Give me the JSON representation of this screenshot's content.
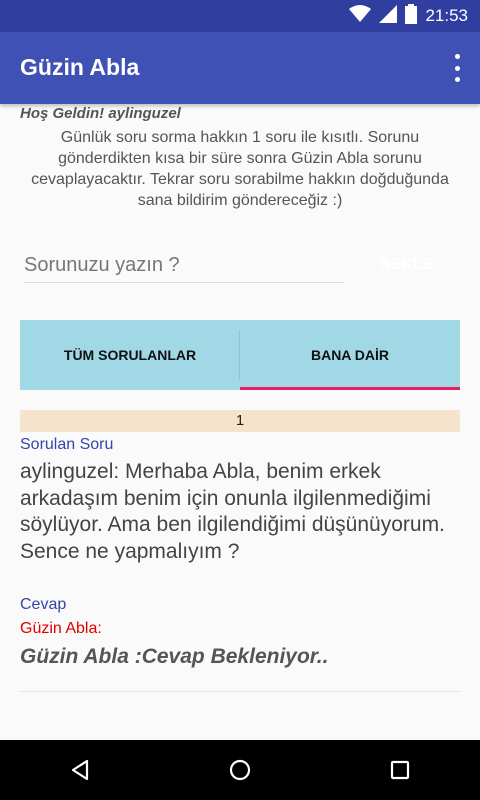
{
  "status_bar": {
    "time": "21:53"
  },
  "app_bar": {
    "title": "Güzin Abla"
  },
  "welcome": "Hoş Geldin! aylinguzel",
  "info_text": "Günlük soru sorma hakkın 1 soru ile kısıtlı. Sorunu gönderdikten kısa bir süre sonra Güzin Abla sorunu cevaplayacaktır. Tekrar soru sorabilme hakkın doğduğunda sana bildirim göndereceğiz :)",
  "ask": {
    "placeholder": "Sorunuzu yazın ?",
    "button_label": "BEKLE"
  },
  "tabs": [
    {
      "label": "TÜM SORULANLAR",
      "active": false
    },
    {
      "label": "BANA DAİR",
      "active": true
    }
  ],
  "entry": {
    "number": "1",
    "question_label": "Sorulan Soru",
    "question": "aylinguzel: Merhaba Abla, benim erkek arkadaşım benim için onunla ilgilenmediğimi söylüyor. Ama ben ilgilendiğimi düşünüyorum. Sence ne yapmalıyım ?",
    "answer_label": "Cevap",
    "answer_author": "Güzin Abla:",
    "answer": "Güzin Abla :Cevap Bekleniyor.."
  },
  "colors": {
    "status_bar": "#303F9F",
    "app_bar": "#3F51B5",
    "tabs_bg": "#A0D8E6",
    "tab_indicator": "#E91E63",
    "counter_bg": "#F5E3CC",
    "label_blue": "#3344AA",
    "author_red": "#E00000"
  },
  "icons": [
    "wifi-icon",
    "signal-icon",
    "battery-icon",
    "overflow-menu-icon",
    "nav-back-icon",
    "nav-home-icon",
    "nav-recents-icon"
  ]
}
